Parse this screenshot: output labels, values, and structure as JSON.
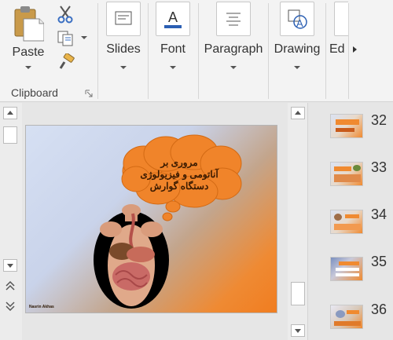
{
  "ribbon": {
    "clipboard": {
      "paste_label": "Paste",
      "group_label": "Clipboard"
    },
    "groups": [
      {
        "label": "Slides",
        "icon": "slides-icon"
      },
      {
        "label": "Font",
        "icon": "font-color-icon"
      },
      {
        "label": "Paragraph",
        "icon": "paragraph-icon"
      },
      {
        "label": "Drawing",
        "icon": "shapes-icon"
      },
      {
        "label": "Ed",
        "icon": "editing-icon"
      }
    ]
  },
  "slide": {
    "bubble_lines": [
      "مروری بر",
      "آناتومی و فیزیولوژی",
      "دستگاه گوارش"
    ],
    "author": "Nasrin Akhas"
  },
  "slide_panel": {
    "numbers": [
      "32",
      "33",
      "34",
      "35",
      "36"
    ]
  },
  "colors": {
    "accent": "#f08a30",
    "bubble": "#f08a2a",
    "ribbon_bg": "#f3f3f3"
  }
}
